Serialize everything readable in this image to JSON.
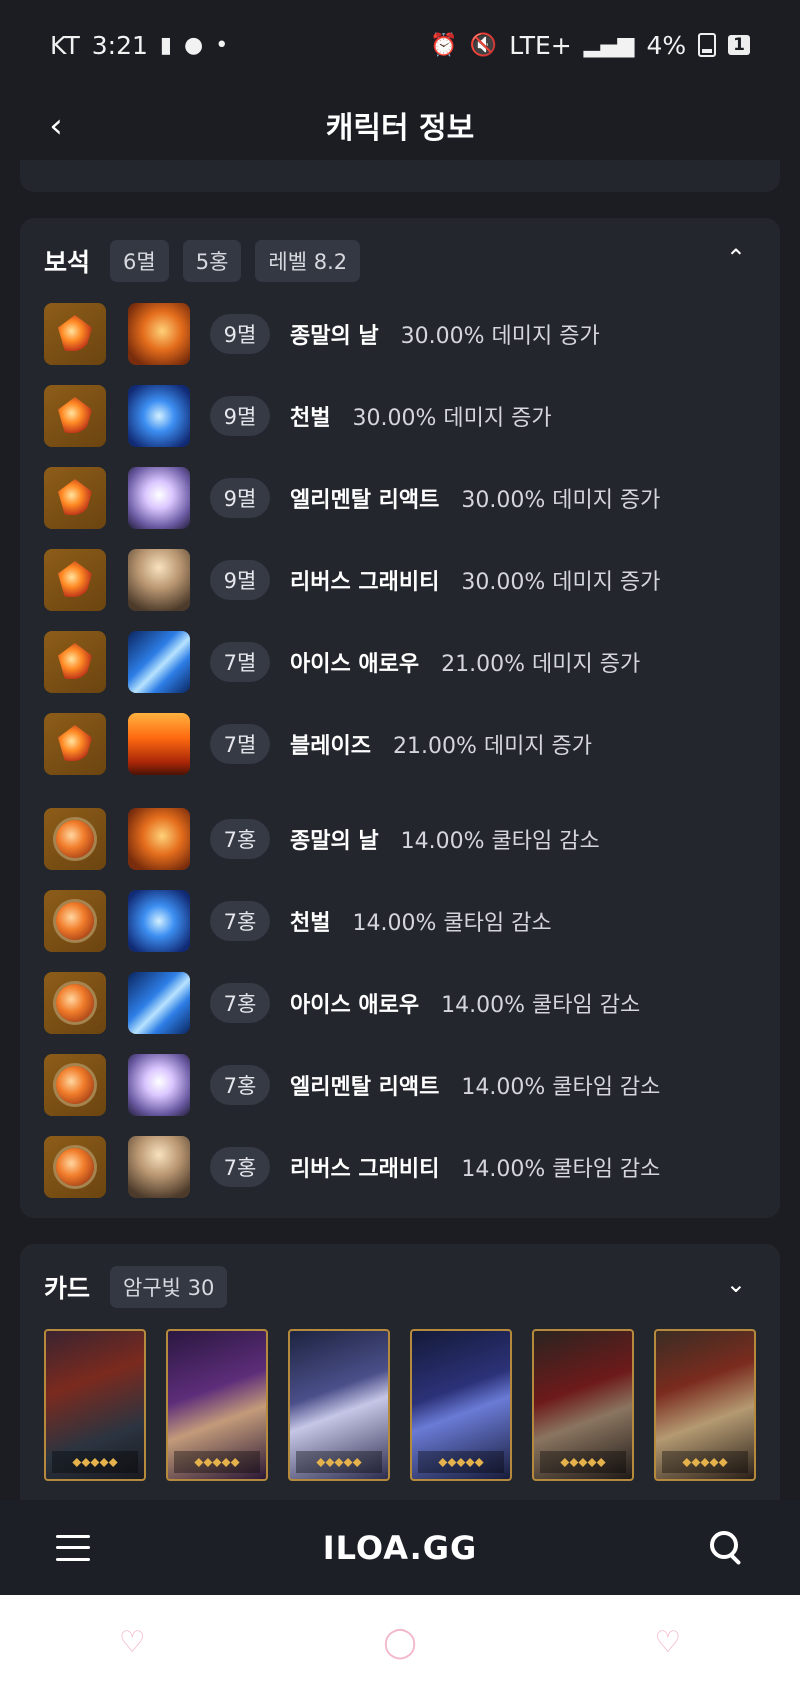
{
  "status_bar": {
    "carrier": "KT",
    "time": "3:21",
    "left_icons": [
      "chat-icon",
      "cloud-icon",
      "dot-icon"
    ],
    "network": "LTE+",
    "battery": "4%",
    "sim": "1"
  },
  "header": {
    "title": "캐릭터 정보"
  },
  "gems": {
    "title": "보석",
    "chips": [
      "6멸",
      "5홍",
      "레벨 8.2"
    ],
    "rows": [
      {
        "level": "9멸",
        "skill": "종말의 날",
        "effect": "30.00% 데미지 증가",
        "gem_type": "damage",
        "skill_icon": "doomsday-icon"
      },
      {
        "level": "9멸",
        "skill": "천벌",
        "effect": "30.00% 데미지 증가",
        "gem_type": "damage",
        "skill_icon": "punishment-icon"
      },
      {
        "level": "9멸",
        "skill": "엘리멘탈 리액트",
        "effect": "30.00% 데미지 증가",
        "gem_type": "damage",
        "skill_icon": "elemental-react-icon"
      },
      {
        "level": "9멸",
        "skill": "리버스 그래비티",
        "effect": "30.00% 데미지 증가",
        "gem_type": "damage",
        "skill_icon": "reverse-gravity-icon"
      },
      {
        "level": "7멸",
        "skill": "아이스 애로우",
        "effect": "21.00% 데미지 증가",
        "gem_type": "damage",
        "skill_icon": "ice-arrow-icon"
      },
      {
        "level": "7멸",
        "skill": "블레이즈",
        "effect": "21.00% 데미지 증가",
        "gem_type": "damage",
        "skill_icon": "blaze-icon"
      },
      {
        "level": "7홍",
        "skill": "종말의 날",
        "effect": "14.00% 쿨타임 감소",
        "gem_type": "cooldown",
        "skill_icon": "doomsday-icon"
      },
      {
        "level": "7홍",
        "skill": "천벌",
        "effect": "14.00% 쿨타임 감소",
        "gem_type": "cooldown",
        "skill_icon": "punishment-icon"
      },
      {
        "level": "7홍",
        "skill": "아이스 애로우",
        "effect": "14.00% 쿨타임 감소",
        "gem_type": "cooldown",
        "skill_icon": "ice-arrow-icon"
      },
      {
        "level": "7홍",
        "skill": "엘리멘탈 리액트",
        "effect": "14.00% 쿨타임 감소",
        "gem_type": "cooldown",
        "skill_icon": "elemental-react-icon"
      },
      {
        "level": "7홍",
        "skill": "리버스 그래비티",
        "effect": "14.00% 쿨타임 감소",
        "gem_type": "cooldown",
        "skill_icon": "reverse-gravity-icon"
      }
    ]
  },
  "cards": {
    "title": "카드",
    "chip": "암구빛 30",
    "awakening_per_card": 5,
    "items": [
      {
        "icon": "card-demon-dragon"
      },
      {
        "icon": "card-dark-queen"
      },
      {
        "icon": "card-shadow-witch"
      },
      {
        "icon": "card-abyss-knight"
      },
      {
        "icon": "card-jester-wheel"
      },
      {
        "icon": "card-skull-lord"
      }
    ]
  },
  "nav": {
    "logo": "ILOA.GG"
  },
  "colors": {
    "background": "#1b1d23",
    "panel": "#23262d",
    "chip": "#343843",
    "gem_gold": "#8d5d19",
    "accent_pink": "#f2b8cc"
  }
}
